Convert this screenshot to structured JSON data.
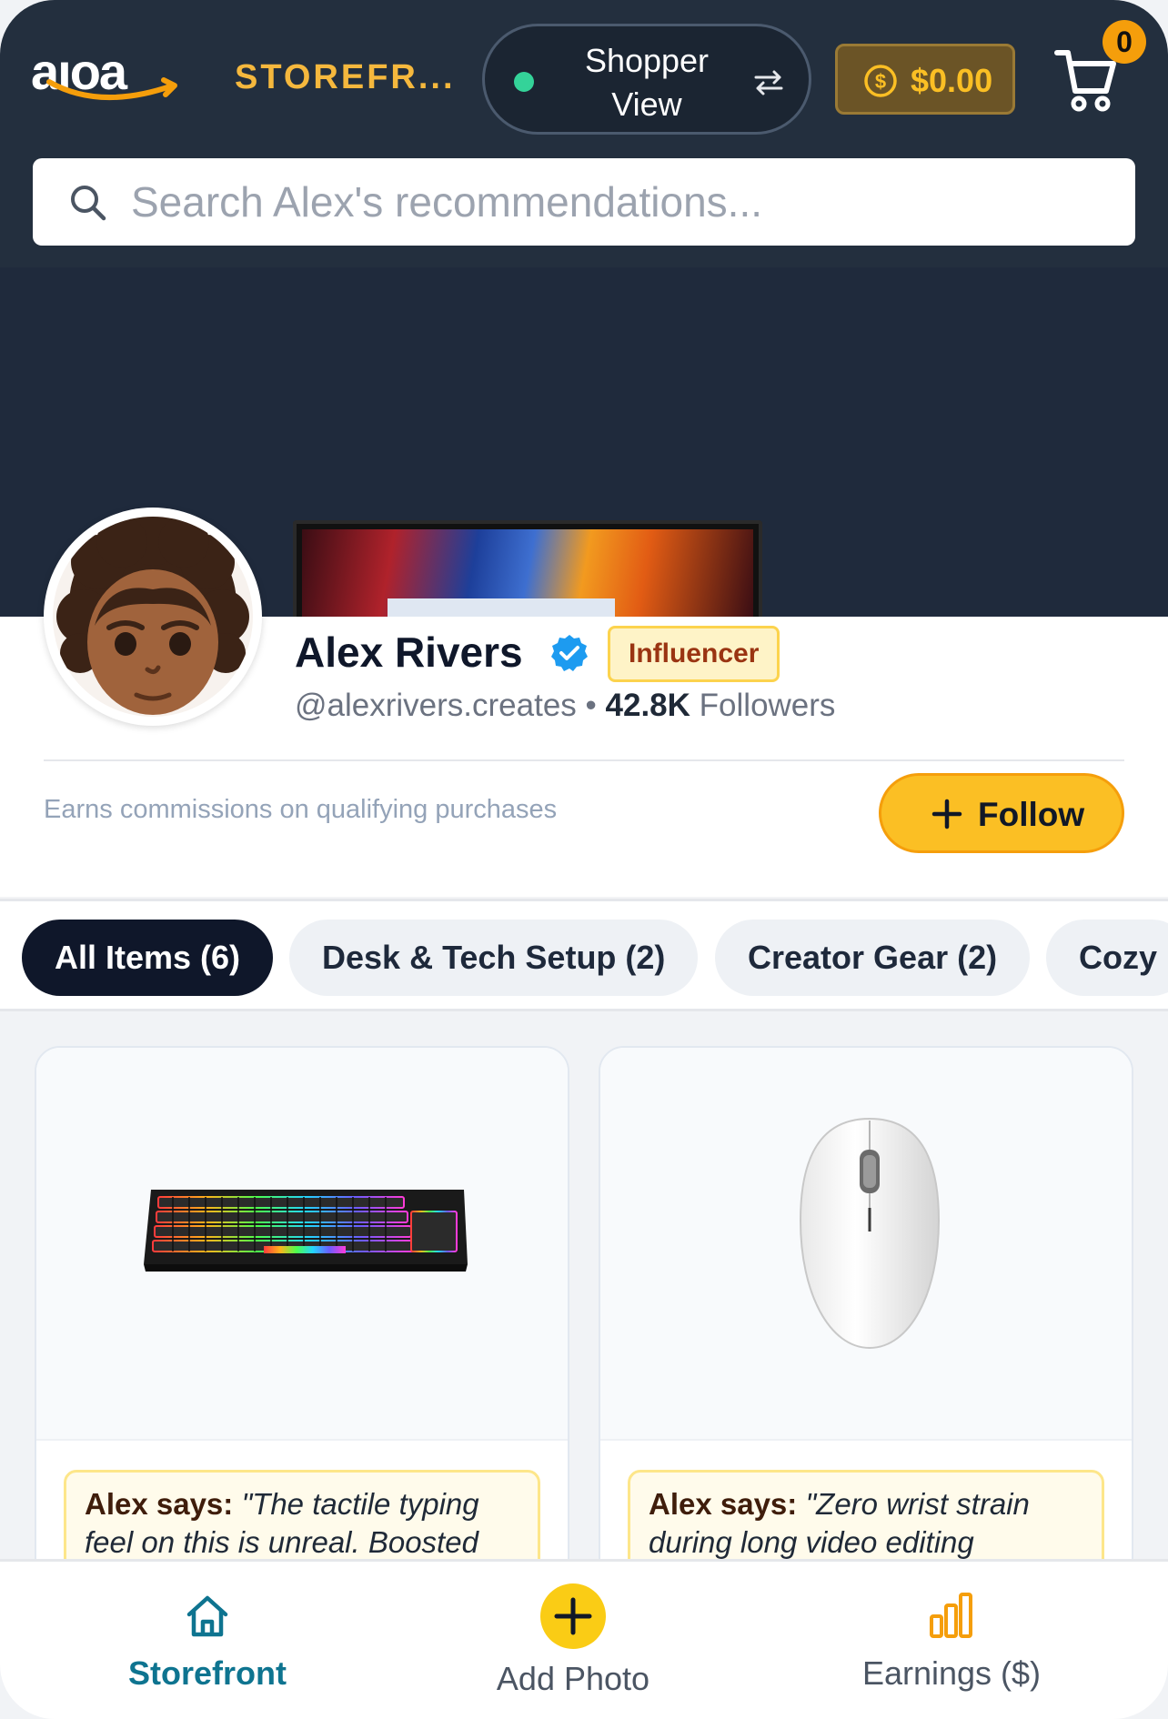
{
  "header": {
    "logo_text": "aıoa",
    "brand_label": "STOREFR...",
    "view_toggle": {
      "line1": "Shopper",
      "line2": "View"
    },
    "balance": "$0.00",
    "cart_count": "0",
    "search": {
      "placeholder": "Search Alex's recommendations...",
      "value": ""
    }
  },
  "profile": {
    "name": "Alex Rivers",
    "role_badge": "Influencer",
    "handle": "@alexrivers.creates",
    "separator": "•",
    "followers_count": "42.8K",
    "followers_label": "Followers",
    "commission_note": "Earns commissions on qualifying purchases",
    "follow_label": "Follow"
  },
  "tabs": [
    {
      "label": "All Items (6)",
      "active": true
    },
    {
      "label": "Desk & Tech Setup (2)",
      "active": false
    },
    {
      "label": "Creator Gear (2)",
      "active": false
    },
    {
      "label": "Cozy",
      "active": false
    }
  ],
  "products": [
    {
      "image": "keyboard",
      "quote_author": "Alex says:",
      "quote_text": "\"The tactile typing feel on this is unreal. Boosted"
    },
    {
      "image": "mouse",
      "quote_author": "Alex says:",
      "quote_text": "\"Zero wrist strain during long video editing"
    }
  ],
  "bottom_nav": {
    "storefront": "Storefront",
    "add_photo": "Add Photo",
    "earnings": "Earnings ($)"
  },
  "colors": {
    "header_bg": "#232f3e",
    "brand_accent": "#f5b83d",
    "follow_button": "#fbbf24",
    "active_tab": "#0f172a",
    "nav_active": "#0e7490"
  }
}
